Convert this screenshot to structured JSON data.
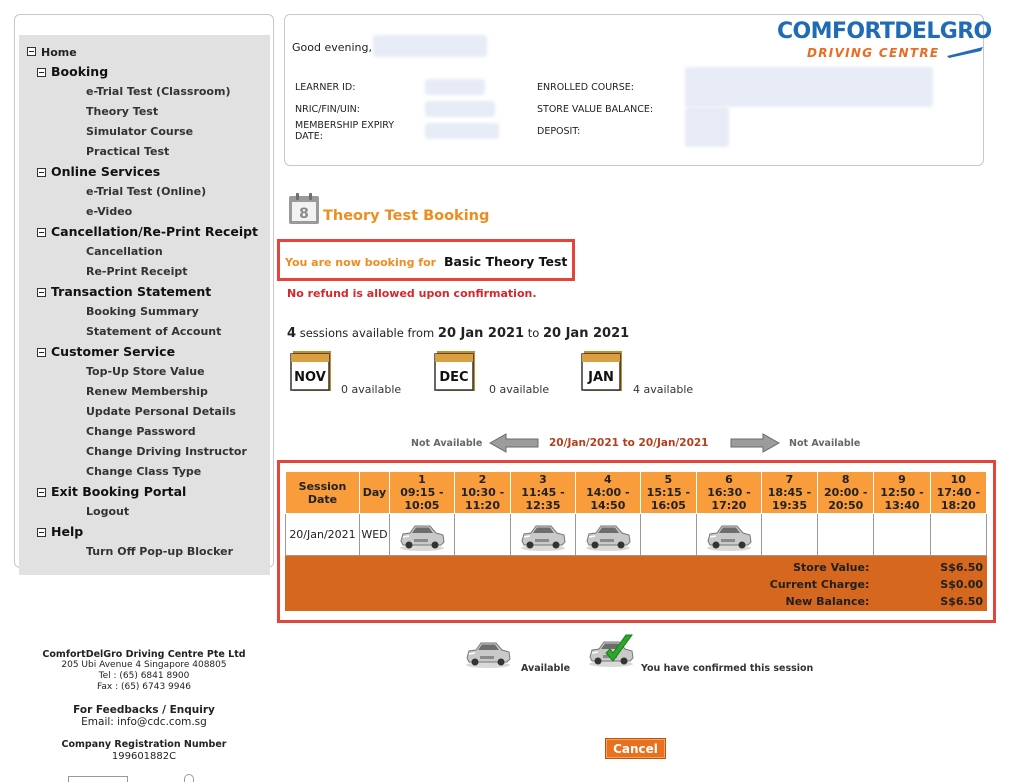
{
  "sidebar": {
    "home": "Home",
    "sections": [
      {
        "label": "Booking",
        "items": [
          "e-Trial Test (Classroom)",
          "Theory Test",
          "Simulator Course",
          "Practical Test"
        ]
      },
      {
        "label": "Online Services",
        "items": [
          "e-Trial Test (Online)",
          "e-Video"
        ]
      },
      {
        "label": "Cancellation/Re-Print Receipt",
        "items": [
          "Cancellation",
          "Re-Print Receipt"
        ]
      },
      {
        "label": "Transaction Statement",
        "items": [
          "Booking Summary",
          "Statement of Account"
        ]
      },
      {
        "label": "Customer Service",
        "items": [
          "Top-Up Store Value",
          "Renew Membership",
          "Update Personal Details",
          "Change Password",
          "Change Driving Instructor",
          "Change Class Type"
        ]
      },
      {
        "label": "Exit Booking Portal",
        "items": [
          "Logout"
        ]
      },
      {
        "label": "Help",
        "items": [
          "Turn Off Pop-up Blocker"
        ]
      }
    ]
  },
  "header": {
    "greeting": "Good evening,",
    "learner_id_label": "LEARNER ID:",
    "nric_label": "NRIC/FIN/UIN:",
    "membership_expiry_label": "MEMBERSHIP EXPIRY",
    "membership_expiry_label2": "DATE:",
    "enrolled_course_label": "ENROLLED COURSE:",
    "store_value_label": "STORE VALUE BALANCE:",
    "deposit_label": "DEPOSIT:",
    "logo_top": "COMFORTDELGRO",
    "logo_bottom": "DRIVING CENTRE",
    "brand_blue": "#1f6bb5",
    "brand_orange": "#ea6b22"
  },
  "booking": {
    "title": "Theory Test Booking",
    "icon_number": "8",
    "booking_for_label": "You are now booking for",
    "booking_type": "Basic Theory Test",
    "no_refund": "No refund is allowed upon confirmation.",
    "sessions_count": "4",
    "sessions_text_a": "sessions available from",
    "date_from": "20 Jan 2021",
    "sessions_text_b": "to",
    "date_to": "20 Jan 2021"
  },
  "months": [
    {
      "name": "NOV",
      "available": "0 available"
    },
    {
      "name": "DEC",
      "available": "0 available"
    },
    {
      "name": "JAN",
      "available": "4 available"
    }
  ],
  "navigation": {
    "prev_text": "Not Available",
    "range": "20/Jan/2021 to 20/Jan/2021",
    "next_text": "Not Available"
  },
  "table": {
    "header_session": "Session Date",
    "header_day": "Day",
    "sessions": [
      {
        "num": "1",
        "time": "09:15 - 10:05"
      },
      {
        "num": "2",
        "time": "10:30 - 11:20"
      },
      {
        "num": "3",
        "time": "11:45 - 12:35"
      },
      {
        "num": "4",
        "time": "14:00 - 14:50"
      },
      {
        "num": "5",
        "time": "15:15 - 16:05"
      },
      {
        "num": "6",
        "time": "16:30 - 17:20"
      },
      {
        "num": "7",
        "time": "18:45 - 19:35"
      },
      {
        "num": "8",
        "time": "20:00 - 20:50"
      },
      {
        "num": "9",
        "time": "12:50 - 13:40"
      },
      {
        "num": "10",
        "time": "17:40 - 18:20"
      }
    ],
    "row": {
      "date": "20/Jan/2021",
      "day": "WED",
      "available": [
        true,
        false,
        true,
        true,
        false,
        true,
        false,
        false,
        false,
        false
      ]
    },
    "summary": {
      "store_value_label": "Store Value:",
      "store_value": "S$6.50",
      "current_charge_label": "Current Charge:",
      "current_charge": "S$0.00",
      "new_balance_label": "New Balance:",
      "new_balance": "S$6.50"
    }
  },
  "legend": {
    "available": "Available",
    "confirmed": "You have confirmed this session"
  },
  "cancel_label": "Cancel",
  "footer": {
    "company": "ComfortDelGro Driving Centre Pte Ltd",
    "address": "205 Ubi Avenue 4 Singapore 408805",
    "tel": "Tel : (65) 6841 8900",
    "fax": "Fax : (65) 6743 9946",
    "feedback_title": "For Feedbacks / Enquiry",
    "email": "Email:  info@cdc.com.sg",
    "reg_title": "Company Registration Number",
    "reg_number": "199601882C"
  }
}
